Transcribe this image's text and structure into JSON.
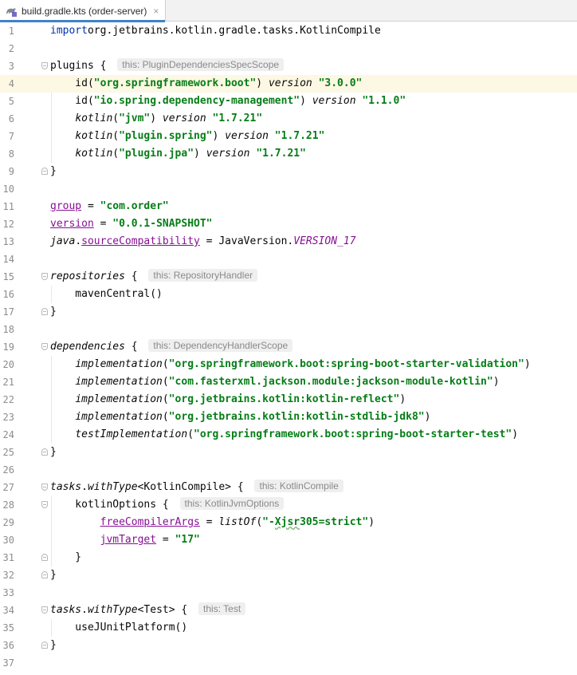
{
  "tab": {
    "label": "build.gradle.kts (order-server)",
    "close": "×",
    "icon": "gradle-kotlin-file-icon"
  },
  "editor": {
    "current_line": 4,
    "lines": [
      {
        "n": "1",
        "seg": [
          [
            "kw",
            "import"
          ],
          [
            "",
            "org.jetbrains.kotlin.gradle.tasks.KotlinCompile"
          ]
        ]
      },
      {
        "n": "2",
        "seg": []
      },
      {
        "n": "3",
        "seg": [
          [
            "",
            "plugins { "
          ]
        ],
        "hint": "this: PluginDependenciesSpecScope"
      },
      {
        "n": "4",
        "seg": [
          [
            "",
            "    id("
          ],
          [
            "str",
            "\"org.springframework.boot\""
          ],
          [
            "",
            ") "
          ],
          [
            "it",
            "version"
          ],
          [
            "",
            " "
          ],
          [
            "str",
            "\"3.0.0\""
          ]
        ]
      },
      {
        "n": "5",
        "seg": [
          [
            "",
            "    id("
          ],
          [
            "str",
            "\"io.spring.dependency-management\""
          ],
          [
            "",
            ") "
          ],
          [
            "it",
            "version"
          ],
          [
            "",
            " "
          ],
          [
            "str",
            "\"1.1.0\""
          ]
        ]
      },
      {
        "n": "6",
        "seg": [
          [
            "",
            "    "
          ],
          [
            "it",
            "kotlin"
          ],
          [
            "",
            "("
          ],
          [
            "str",
            "\"jvm\""
          ],
          [
            "",
            ") "
          ],
          [
            "it",
            "version"
          ],
          [
            "",
            " "
          ],
          [
            "str",
            "\"1.7.21\""
          ]
        ]
      },
      {
        "n": "7",
        "seg": [
          [
            "",
            "    "
          ],
          [
            "it",
            "kotlin"
          ],
          [
            "",
            "("
          ],
          [
            "str",
            "\"plugin.spring\""
          ],
          [
            "",
            ") "
          ],
          [
            "it",
            "version"
          ],
          [
            "",
            " "
          ],
          [
            "str",
            "\"1.7.21\""
          ]
        ]
      },
      {
        "n": "8",
        "seg": [
          [
            "",
            "    "
          ],
          [
            "it",
            "kotlin"
          ],
          [
            "",
            "("
          ],
          [
            "str",
            "\"plugin.jpa\""
          ],
          [
            "",
            ") "
          ],
          [
            "it",
            "version"
          ],
          [
            "",
            " "
          ],
          [
            "str",
            "\"1.7.21\""
          ]
        ]
      },
      {
        "n": "9",
        "seg": [
          [
            "",
            "}"
          ]
        ]
      },
      {
        "n": "10",
        "seg": []
      },
      {
        "n": "11",
        "seg": [
          [
            "prop",
            "group"
          ],
          [
            "",
            " = "
          ],
          [
            "str",
            "\"com.order\""
          ]
        ]
      },
      {
        "n": "12",
        "seg": [
          [
            "prop",
            "version"
          ],
          [
            "",
            " = "
          ],
          [
            "str",
            "\"0.0.1-SNAPSHOT\""
          ]
        ]
      },
      {
        "n": "13",
        "seg": [
          [
            "it",
            "java"
          ],
          [
            "",
            "."
          ],
          [
            "prop",
            "sourceCompatibility"
          ],
          [
            "",
            " = JavaVersion."
          ],
          [
            "field",
            "VERSION_17"
          ]
        ]
      },
      {
        "n": "14",
        "seg": []
      },
      {
        "n": "15",
        "seg": [
          [
            "it",
            "repositories"
          ],
          [
            "",
            " { "
          ]
        ],
        "hint": "this: RepositoryHandler"
      },
      {
        "n": "16",
        "seg": [
          [
            "",
            "    mavenCentral()"
          ]
        ]
      },
      {
        "n": "17",
        "seg": [
          [
            "",
            "}"
          ]
        ]
      },
      {
        "n": "18",
        "seg": []
      },
      {
        "n": "19",
        "seg": [
          [
            "it",
            "dependencies"
          ],
          [
            "",
            " { "
          ]
        ],
        "hint": "this: DependencyHandlerScope"
      },
      {
        "n": "20",
        "seg": [
          [
            "",
            "    "
          ],
          [
            "it",
            "implementation"
          ],
          [
            "",
            "("
          ],
          [
            "str",
            "\"org.springframework.boot:spring-boot-starter-validation\""
          ],
          [
            "",
            ")"
          ]
        ]
      },
      {
        "n": "21",
        "seg": [
          [
            "",
            "    "
          ],
          [
            "it",
            "implementation"
          ],
          [
            "",
            "("
          ],
          [
            "str",
            "\"com.fasterxml.jackson.module:jackson-module-kotlin\""
          ],
          [
            "",
            ")"
          ]
        ]
      },
      {
        "n": "22",
        "seg": [
          [
            "",
            "    "
          ],
          [
            "it",
            "implementation"
          ],
          [
            "",
            "("
          ],
          [
            "str",
            "\"org.jetbrains.kotlin:kotlin-reflect\""
          ],
          [
            "",
            ")"
          ]
        ]
      },
      {
        "n": "23",
        "seg": [
          [
            "",
            "    "
          ],
          [
            "it",
            "implementation"
          ],
          [
            "",
            "("
          ],
          [
            "str",
            "\"org.jetbrains.kotlin:kotlin-stdlib-jdk8\""
          ],
          [
            "",
            ")"
          ]
        ]
      },
      {
        "n": "24",
        "seg": [
          [
            "",
            "    "
          ],
          [
            "it",
            "testImplementation"
          ],
          [
            "",
            "("
          ],
          [
            "str",
            "\"org.springframework.boot:spring-boot-starter-test\""
          ],
          [
            "",
            ")"
          ]
        ]
      },
      {
        "n": "25",
        "seg": [
          [
            "",
            "}"
          ]
        ]
      },
      {
        "n": "26",
        "seg": []
      },
      {
        "n": "27",
        "seg": [
          [
            "it",
            "tasks"
          ],
          [
            "",
            "."
          ],
          [
            "it",
            "withType"
          ],
          [
            "",
            "<KotlinCompile> { "
          ]
        ],
        "hint": "this: KotlinCompile"
      },
      {
        "n": "28",
        "seg": [
          [
            "",
            "    kotlinOptions { "
          ]
        ],
        "hint": "this: KotlinJvmOptions"
      },
      {
        "n": "29",
        "seg": [
          [
            "",
            "        "
          ],
          [
            "prop",
            "freeCompilerArgs"
          ],
          [
            "",
            " = "
          ],
          [
            "it",
            "listOf"
          ],
          [
            "",
            "("
          ],
          [
            "str",
            "\"-"
          ],
          [
            "str squig",
            "Xjsr"
          ],
          [
            "str",
            "305=strict\""
          ],
          [
            "",
            ")"
          ]
        ]
      },
      {
        "n": "30",
        "seg": [
          [
            "",
            "        "
          ],
          [
            "prop",
            "jvmTarget"
          ],
          [
            "",
            " = "
          ],
          [
            "str",
            "\"17\""
          ]
        ]
      },
      {
        "n": "31",
        "seg": [
          [
            "",
            "    }"
          ]
        ]
      },
      {
        "n": "32",
        "seg": [
          [
            "",
            "}"
          ]
        ]
      },
      {
        "n": "33",
        "seg": []
      },
      {
        "n": "34",
        "seg": [
          [
            "it",
            "tasks"
          ],
          [
            "",
            "."
          ],
          [
            "it",
            "withType"
          ],
          [
            "",
            "<Test> { "
          ]
        ],
        "hint": "this: Test"
      },
      {
        "n": "35",
        "seg": [
          [
            "",
            "    useJUnitPlatform()"
          ]
        ]
      },
      {
        "n": "36",
        "seg": [
          [
            "",
            "}"
          ]
        ]
      },
      {
        "n": "37",
        "seg": []
      }
    ],
    "folds": {
      "open": [
        3,
        15,
        19,
        27,
        28,
        34
      ],
      "close": [
        9,
        17,
        25,
        31,
        32,
        36
      ]
    }
  }
}
